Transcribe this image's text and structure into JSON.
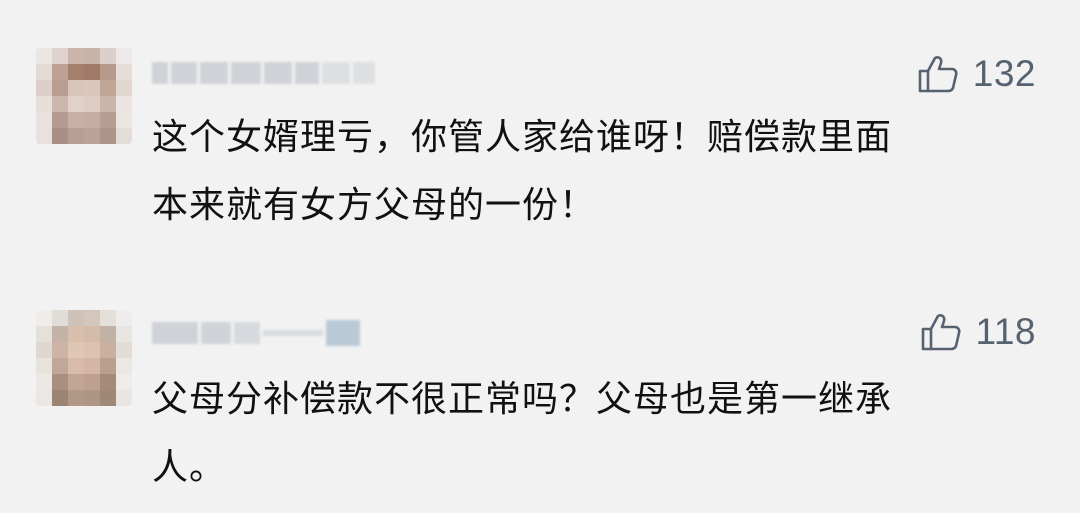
{
  "comments": [
    {
      "likes": "132",
      "text": "这个女婿理亏，你管人家给谁呀！赔偿款里面\n本来就有女方父母的一份！",
      "icon": "thumbs-up-icon"
    },
    {
      "likes": "118",
      "text": "父母分补偿款不很正常吗？父母也是第一继承\n人。",
      "icon": "thumbs-up-icon"
    }
  ],
  "colors": {
    "background": "#f2f2f2",
    "text": "#111111",
    "like": "#566270"
  }
}
